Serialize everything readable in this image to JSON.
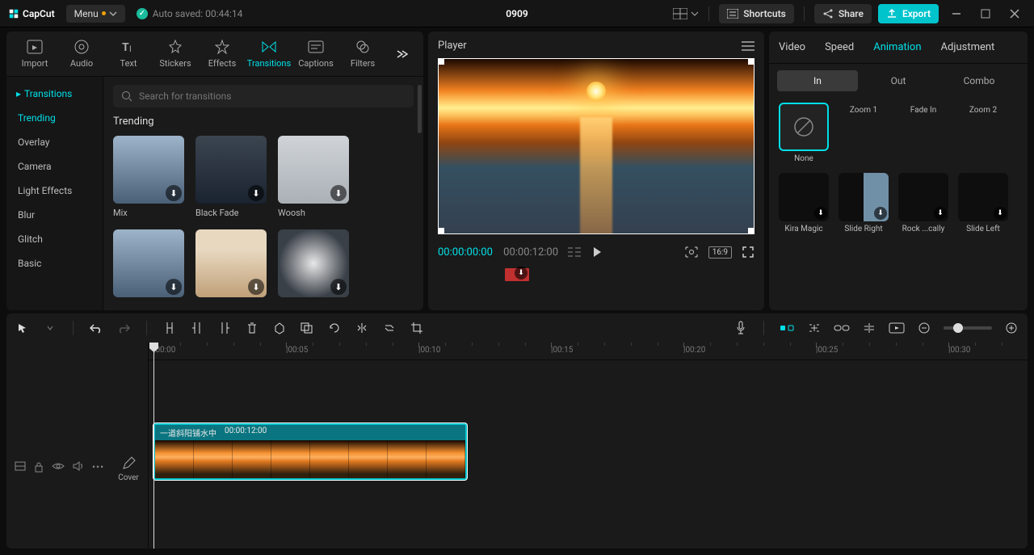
{
  "app": {
    "name": "CapCut",
    "menu": "Menu",
    "autosave": "Auto saved:  00:44:14",
    "title": "0909"
  },
  "top": {
    "shortcuts": "Shortcuts",
    "share": "Share",
    "export": "Export"
  },
  "leftTabs": [
    "Import",
    "Audio",
    "Text",
    "Stickers",
    "Effects",
    "Transitions",
    "Captions",
    "Filters"
  ],
  "leftActiveTab": "Transitions",
  "catHead": "Transitions",
  "categories": [
    "Trending",
    "Overlay",
    "Camera",
    "Light Effects",
    "Blur",
    "Glitch",
    "Basic"
  ],
  "catActive": "Trending",
  "searchPlaceholder": "Search for transitions",
  "gridTitle": "Trending",
  "thumbs": [
    {
      "label": "Mix",
      "style": "sky"
    },
    {
      "label": "Black Fade",
      "style": "dark"
    },
    {
      "label": "Woosh",
      "style": "car"
    },
    {
      "label": "",
      "style": "sky"
    },
    {
      "label": "",
      "style": "pale"
    },
    {
      "label": "",
      "style": "wind"
    }
  ],
  "player": {
    "title": "Player",
    "current": "00:00:00:00",
    "total": "00:00:12:00",
    "ratio": "16:9"
  },
  "rightTabs": [
    "Video",
    "Speed",
    "Animation",
    "Adjustment"
  ],
  "rightActive": "Animation",
  "rightSub": [
    "In",
    "Out",
    "Combo"
  ],
  "rightSubActive": "In",
  "animations": [
    {
      "label": "None",
      "style": "none"
    },
    {
      "label": "Zoom 1",
      "style": "cable"
    },
    {
      "label": "Fade In",
      "style": "cable"
    },
    {
      "label": "Zoom 2",
      "style": "cable"
    },
    {
      "label": "Kira Magic",
      "style": "black"
    },
    {
      "label": "Slide Right",
      "style": "split"
    },
    {
      "label": "Rock ...cally",
      "style": "black"
    },
    {
      "label": "Slide Left",
      "style": "black"
    },
    {
      "label": "",
      "style": "cable"
    },
    {
      "label": "",
      "style": "cable"
    },
    {
      "label": "",
      "style": "cable"
    },
    {
      "label": "",
      "style": "cable"
    }
  ],
  "timeline": {
    "ticks": [
      "|00:00",
      "|00:05",
      "|00:10",
      "|00:15",
      "|00:20",
      "|00:25",
      "|00:30"
    ],
    "clipName": "一道斜阳铺水中",
    "clipDur": "00:00:12:00",
    "cover": "Cover"
  }
}
